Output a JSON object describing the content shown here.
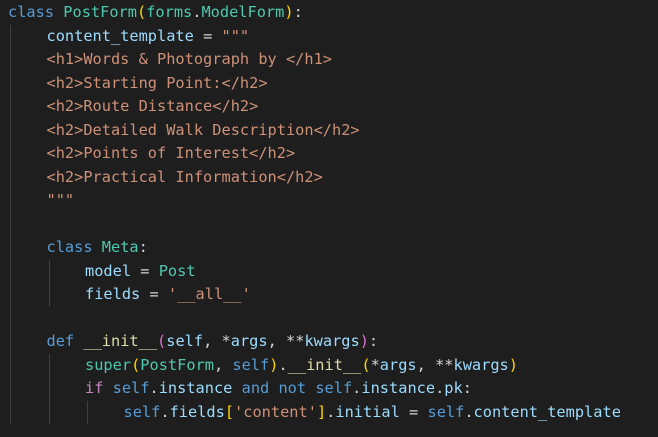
{
  "editor": {
    "language": "python",
    "colors": {
      "background": "#1e1e1e",
      "default": "#d4d4d4",
      "keyword": "#569cd6",
      "control": "#c586c0",
      "class": "#4ec9b0",
      "function": "#dcdcaa",
      "variable": "#9cdcfe",
      "string": "#ce9178",
      "bracket1": "#ffd700",
      "bracket2": "#da70d6",
      "bracket3": "#179fff",
      "indent_guide": "#404040"
    },
    "lines": [
      {
        "indent": 0,
        "tokens": [
          {
            "t": "class",
            "c": "keyword"
          },
          {
            "t": " ",
            "c": "default"
          },
          {
            "t": "PostForm",
            "c": "class"
          },
          {
            "t": "(",
            "c": "bracket1"
          },
          {
            "t": "forms",
            "c": "class"
          },
          {
            "t": ".",
            "c": "default"
          },
          {
            "t": "ModelForm",
            "c": "class"
          },
          {
            "t": ")",
            "c": "bracket1"
          },
          {
            "t": ":",
            "c": "default"
          }
        ]
      },
      {
        "indent": 1,
        "tokens": [
          {
            "t": "content_template",
            "c": "variable"
          },
          {
            "t": " = ",
            "c": "default"
          },
          {
            "t": "\"\"\"",
            "c": "string"
          }
        ]
      },
      {
        "indent": 1,
        "tokens": [
          {
            "t": "<h1>Words & Photograph by </h1>",
            "c": "string"
          }
        ]
      },
      {
        "indent": 1,
        "tokens": [
          {
            "t": "<h2>Starting Point:</h2>",
            "c": "string"
          }
        ]
      },
      {
        "indent": 1,
        "tokens": [
          {
            "t": "<h2>Route Distance</h2>",
            "c": "string"
          }
        ]
      },
      {
        "indent": 1,
        "tokens": [
          {
            "t": "<h2>Detailed Walk Description</h2>",
            "c": "string"
          }
        ]
      },
      {
        "indent": 1,
        "tokens": [
          {
            "t": "<h2>Points of Interest</h2>",
            "c": "string"
          }
        ]
      },
      {
        "indent": 1,
        "tokens": [
          {
            "t": "<h2>Practical Information</h2>",
            "c": "string"
          }
        ]
      },
      {
        "indent": 1,
        "tokens": [
          {
            "t": "\"\"\"",
            "c": "string"
          }
        ]
      },
      {
        "indent": 0,
        "tokens": []
      },
      {
        "indent": 1,
        "tokens": [
          {
            "t": "class",
            "c": "keyword"
          },
          {
            "t": " ",
            "c": "default"
          },
          {
            "t": "Meta",
            "c": "class"
          },
          {
            "t": ":",
            "c": "default"
          }
        ]
      },
      {
        "indent": 2,
        "tokens": [
          {
            "t": "model",
            "c": "variable"
          },
          {
            "t": " = ",
            "c": "default"
          },
          {
            "t": "Post",
            "c": "class"
          }
        ]
      },
      {
        "indent": 2,
        "tokens": [
          {
            "t": "fields",
            "c": "variable"
          },
          {
            "t": " = ",
            "c": "default"
          },
          {
            "t": "'__all__'",
            "c": "string"
          }
        ]
      },
      {
        "indent": 0,
        "tokens": []
      },
      {
        "indent": 1,
        "tokens": [
          {
            "t": "def",
            "c": "keyword"
          },
          {
            "t": " ",
            "c": "default"
          },
          {
            "t": "__init__",
            "c": "function"
          },
          {
            "t": "(",
            "c": "bracket2"
          },
          {
            "t": "self",
            "c": "variable"
          },
          {
            "t": ", ",
            "c": "default"
          },
          {
            "t": "*",
            "c": "default"
          },
          {
            "t": "args",
            "c": "variable"
          },
          {
            "t": ", ",
            "c": "default"
          },
          {
            "t": "**",
            "c": "default"
          },
          {
            "t": "kwargs",
            "c": "variable"
          },
          {
            "t": ")",
            "c": "bracket2"
          },
          {
            "t": ":",
            "c": "default"
          }
        ]
      },
      {
        "indent": 2,
        "tokens": [
          {
            "t": "super",
            "c": "class"
          },
          {
            "t": "(",
            "c": "bracket1"
          },
          {
            "t": "PostForm",
            "c": "class"
          },
          {
            "t": ", ",
            "c": "default"
          },
          {
            "t": "self",
            "c": "keyword"
          },
          {
            "t": ")",
            "c": "bracket1"
          },
          {
            "t": ".",
            "c": "default"
          },
          {
            "t": "__init__",
            "c": "function"
          },
          {
            "t": "(",
            "c": "bracket1"
          },
          {
            "t": "*",
            "c": "default"
          },
          {
            "t": "args",
            "c": "variable"
          },
          {
            "t": ", ",
            "c": "default"
          },
          {
            "t": "**",
            "c": "default"
          },
          {
            "t": "kwargs",
            "c": "variable"
          },
          {
            "t": ")",
            "c": "bracket1"
          }
        ]
      },
      {
        "indent": 2,
        "tokens": [
          {
            "t": "if",
            "c": "control"
          },
          {
            "t": " ",
            "c": "default"
          },
          {
            "t": "self",
            "c": "keyword"
          },
          {
            "t": ".",
            "c": "default"
          },
          {
            "t": "instance",
            "c": "variable"
          },
          {
            "t": " ",
            "c": "default"
          },
          {
            "t": "and",
            "c": "keyword"
          },
          {
            "t": " ",
            "c": "default"
          },
          {
            "t": "not",
            "c": "keyword"
          },
          {
            "t": " ",
            "c": "default"
          },
          {
            "t": "self",
            "c": "keyword"
          },
          {
            "t": ".",
            "c": "default"
          },
          {
            "t": "instance",
            "c": "variable"
          },
          {
            "t": ".",
            "c": "default"
          },
          {
            "t": "pk",
            "c": "variable"
          },
          {
            "t": ":",
            "c": "default"
          }
        ]
      },
      {
        "indent": 3,
        "tokens": [
          {
            "t": "self",
            "c": "keyword"
          },
          {
            "t": ".",
            "c": "default"
          },
          {
            "t": "fields",
            "c": "variable"
          },
          {
            "t": "[",
            "c": "bracket1"
          },
          {
            "t": "'content'",
            "c": "string"
          },
          {
            "t": "]",
            "c": "bracket1"
          },
          {
            "t": ".",
            "c": "default"
          },
          {
            "t": "initial",
            "c": "variable"
          },
          {
            "t": " = ",
            "c": "default"
          },
          {
            "t": "self",
            "c": "keyword"
          },
          {
            "t": ".",
            "c": "default"
          },
          {
            "t": "content_template",
            "c": "variable"
          }
        ]
      }
    ]
  }
}
